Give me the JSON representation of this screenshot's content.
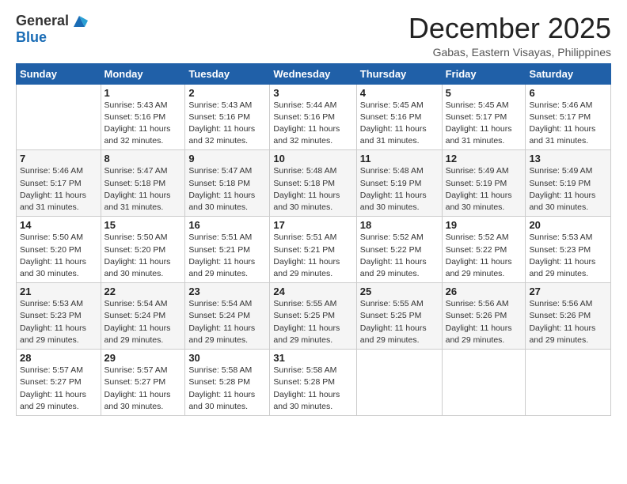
{
  "logo": {
    "general": "General",
    "blue": "Blue"
  },
  "header": {
    "month_year": "December 2025",
    "location": "Gabas, Eastern Visayas, Philippines"
  },
  "weekdays": [
    "Sunday",
    "Monday",
    "Tuesday",
    "Wednesday",
    "Thursday",
    "Friday",
    "Saturday"
  ],
  "weeks": [
    [
      {
        "day": "",
        "sunrise": "",
        "sunset": "",
        "daylight": ""
      },
      {
        "day": "1",
        "sunrise": "Sunrise: 5:43 AM",
        "sunset": "Sunset: 5:16 PM",
        "daylight": "Daylight: 11 hours and 32 minutes."
      },
      {
        "day": "2",
        "sunrise": "Sunrise: 5:43 AM",
        "sunset": "Sunset: 5:16 PM",
        "daylight": "Daylight: 11 hours and 32 minutes."
      },
      {
        "day": "3",
        "sunrise": "Sunrise: 5:44 AM",
        "sunset": "Sunset: 5:16 PM",
        "daylight": "Daylight: 11 hours and 32 minutes."
      },
      {
        "day": "4",
        "sunrise": "Sunrise: 5:45 AM",
        "sunset": "Sunset: 5:16 PM",
        "daylight": "Daylight: 11 hours and 31 minutes."
      },
      {
        "day": "5",
        "sunrise": "Sunrise: 5:45 AM",
        "sunset": "Sunset: 5:17 PM",
        "daylight": "Daylight: 11 hours and 31 minutes."
      },
      {
        "day": "6",
        "sunrise": "Sunrise: 5:46 AM",
        "sunset": "Sunset: 5:17 PM",
        "daylight": "Daylight: 11 hours and 31 minutes."
      }
    ],
    [
      {
        "day": "7",
        "sunrise": "Sunrise: 5:46 AM",
        "sunset": "Sunset: 5:17 PM",
        "daylight": "Daylight: 11 hours and 31 minutes."
      },
      {
        "day": "8",
        "sunrise": "Sunrise: 5:47 AM",
        "sunset": "Sunset: 5:18 PM",
        "daylight": "Daylight: 11 hours and 31 minutes."
      },
      {
        "day": "9",
        "sunrise": "Sunrise: 5:47 AM",
        "sunset": "Sunset: 5:18 PM",
        "daylight": "Daylight: 11 hours and 30 minutes."
      },
      {
        "day": "10",
        "sunrise": "Sunrise: 5:48 AM",
        "sunset": "Sunset: 5:18 PM",
        "daylight": "Daylight: 11 hours and 30 minutes."
      },
      {
        "day": "11",
        "sunrise": "Sunrise: 5:48 AM",
        "sunset": "Sunset: 5:19 PM",
        "daylight": "Daylight: 11 hours and 30 minutes."
      },
      {
        "day": "12",
        "sunrise": "Sunrise: 5:49 AM",
        "sunset": "Sunset: 5:19 PM",
        "daylight": "Daylight: 11 hours and 30 minutes."
      },
      {
        "day": "13",
        "sunrise": "Sunrise: 5:49 AM",
        "sunset": "Sunset: 5:19 PM",
        "daylight": "Daylight: 11 hours and 30 minutes."
      }
    ],
    [
      {
        "day": "14",
        "sunrise": "Sunrise: 5:50 AM",
        "sunset": "Sunset: 5:20 PM",
        "daylight": "Daylight: 11 hours and 30 minutes."
      },
      {
        "day": "15",
        "sunrise": "Sunrise: 5:50 AM",
        "sunset": "Sunset: 5:20 PM",
        "daylight": "Daylight: 11 hours and 30 minutes."
      },
      {
        "day": "16",
        "sunrise": "Sunrise: 5:51 AM",
        "sunset": "Sunset: 5:21 PM",
        "daylight": "Daylight: 11 hours and 29 minutes."
      },
      {
        "day": "17",
        "sunrise": "Sunrise: 5:51 AM",
        "sunset": "Sunset: 5:21 PM",
        "daylight": "Daylight: 11 hours and 29 minutes."
      },
      {
        "day": "18",
        "sunrise": "Sunrise: 5:52 AM",
        "sunset": "Sunset: 5:22 PM",
        "daylight": "Daylight: 11 hours and 29 minutes."
      },
      {
        "day": "19",
        "sunrise": "Sunrise: 5:52 AM",
        "sunset": "Sunset: 5:22 PM",
        "daylight": "Daylight: 11 hours and 29 minutes."
      },
      {
        "day": "20",
        "sunrise": "Sunrise: 5:53 AM",
        "sunset": "Sunset: 5:23 PM",
        "daylight": "Daylight: 11 hours and 29 minutes."
      }
    ],
    [
      {
        "day": "21",
        "sunrise": "Sunrise: 5:53 AM",
        "sunset": "Sunset: 5:23 PM",
        "daylight": "Daylight: 11 hours and 29 minutes."
      },
      {
        "day": "22",
        "sunrise": "Sunrise: 5:54 AM",
        "sunset": "Sunset: 5:24 PM",
        "daylight": "Daylight: 11 hours and 29 minutes."
      },
      {
        "day": "23",
        "sunrise": "Sunrise: 5:54 AM",
        "sunset": "Sunset: 5:24 PM",
        "daylight": "Daylight: 11 hours and 29 minutes."
      },
      {
        "day": "24",
        "sunrise": "Sunrise: 5:55 AM",
        "sunset": "Sunset: 5:25 PM",
        "daylight": "Daylight: 11 hours and 29 minutes."
      },
      {
        "day": "25",
        "sunrise": "Sunrise: 5:55 AM",
        "sunset": "Sunset: 5:25 PM",
        "daylight": "Daylight: 11 hours and 29 minutes."
      },
      {
        "day": "26",
        "sunrise": "Sunrise: 5:56 AM",
        "sunset": "Sunset: 5:26 PM",
        "daylight": "Daylight: 11 hours and 29 minutes."
      },
      {
        "day": "27",
        "sunrise": "Sunrise: 5:56 AM",
        "sunset": "Sunset: 5:26 PM",
        "daylight": "Daylight: 11 hours and 29 minutes."
      }
    ],
    [
      {
        "day": "28",
        "sunrise": "Sunrise: 5:57 AM",
        "sunset": "Sunset: 5:27 PM",
        "daylight": "Daylight: 11 hours and 29 minutes."
      },
      {
        "day": "29",
        "sunrise": "Sunrise: 5:57 AM",
        "sunset": "Sunset: 5:27 PM",
        "daylight": "Daylight: 11 hours and 30 minutes."
      },
      {
        "day": "30",
        "sunrise": "Sunrise: 5:58 AM",
        "sunset": "Sunset: 5:28 PM",
        "daylight": "Daylight: 11 hours and 30 minutes."
      },
      {
        "day": "31",
        "sunrise": "Sunrise: 5:58 AM",
        "sunset": "Sunset: 5:28 PM",
        "daylight": "Daylight: 11 hours and 30 minutes."
      },
      {
        "day": "",
        "sunrise": "",
        "sunset": "",
        "daylight": ""
      },
      {
        "day": "",
        "sunrise": "",
        "sunset": "",
        "daylight": ""
      },
      {
        "day": "",
        "sunrise": "",
        "sunset": "",
        "daylight": ""
      }
    ]
  ]
}
